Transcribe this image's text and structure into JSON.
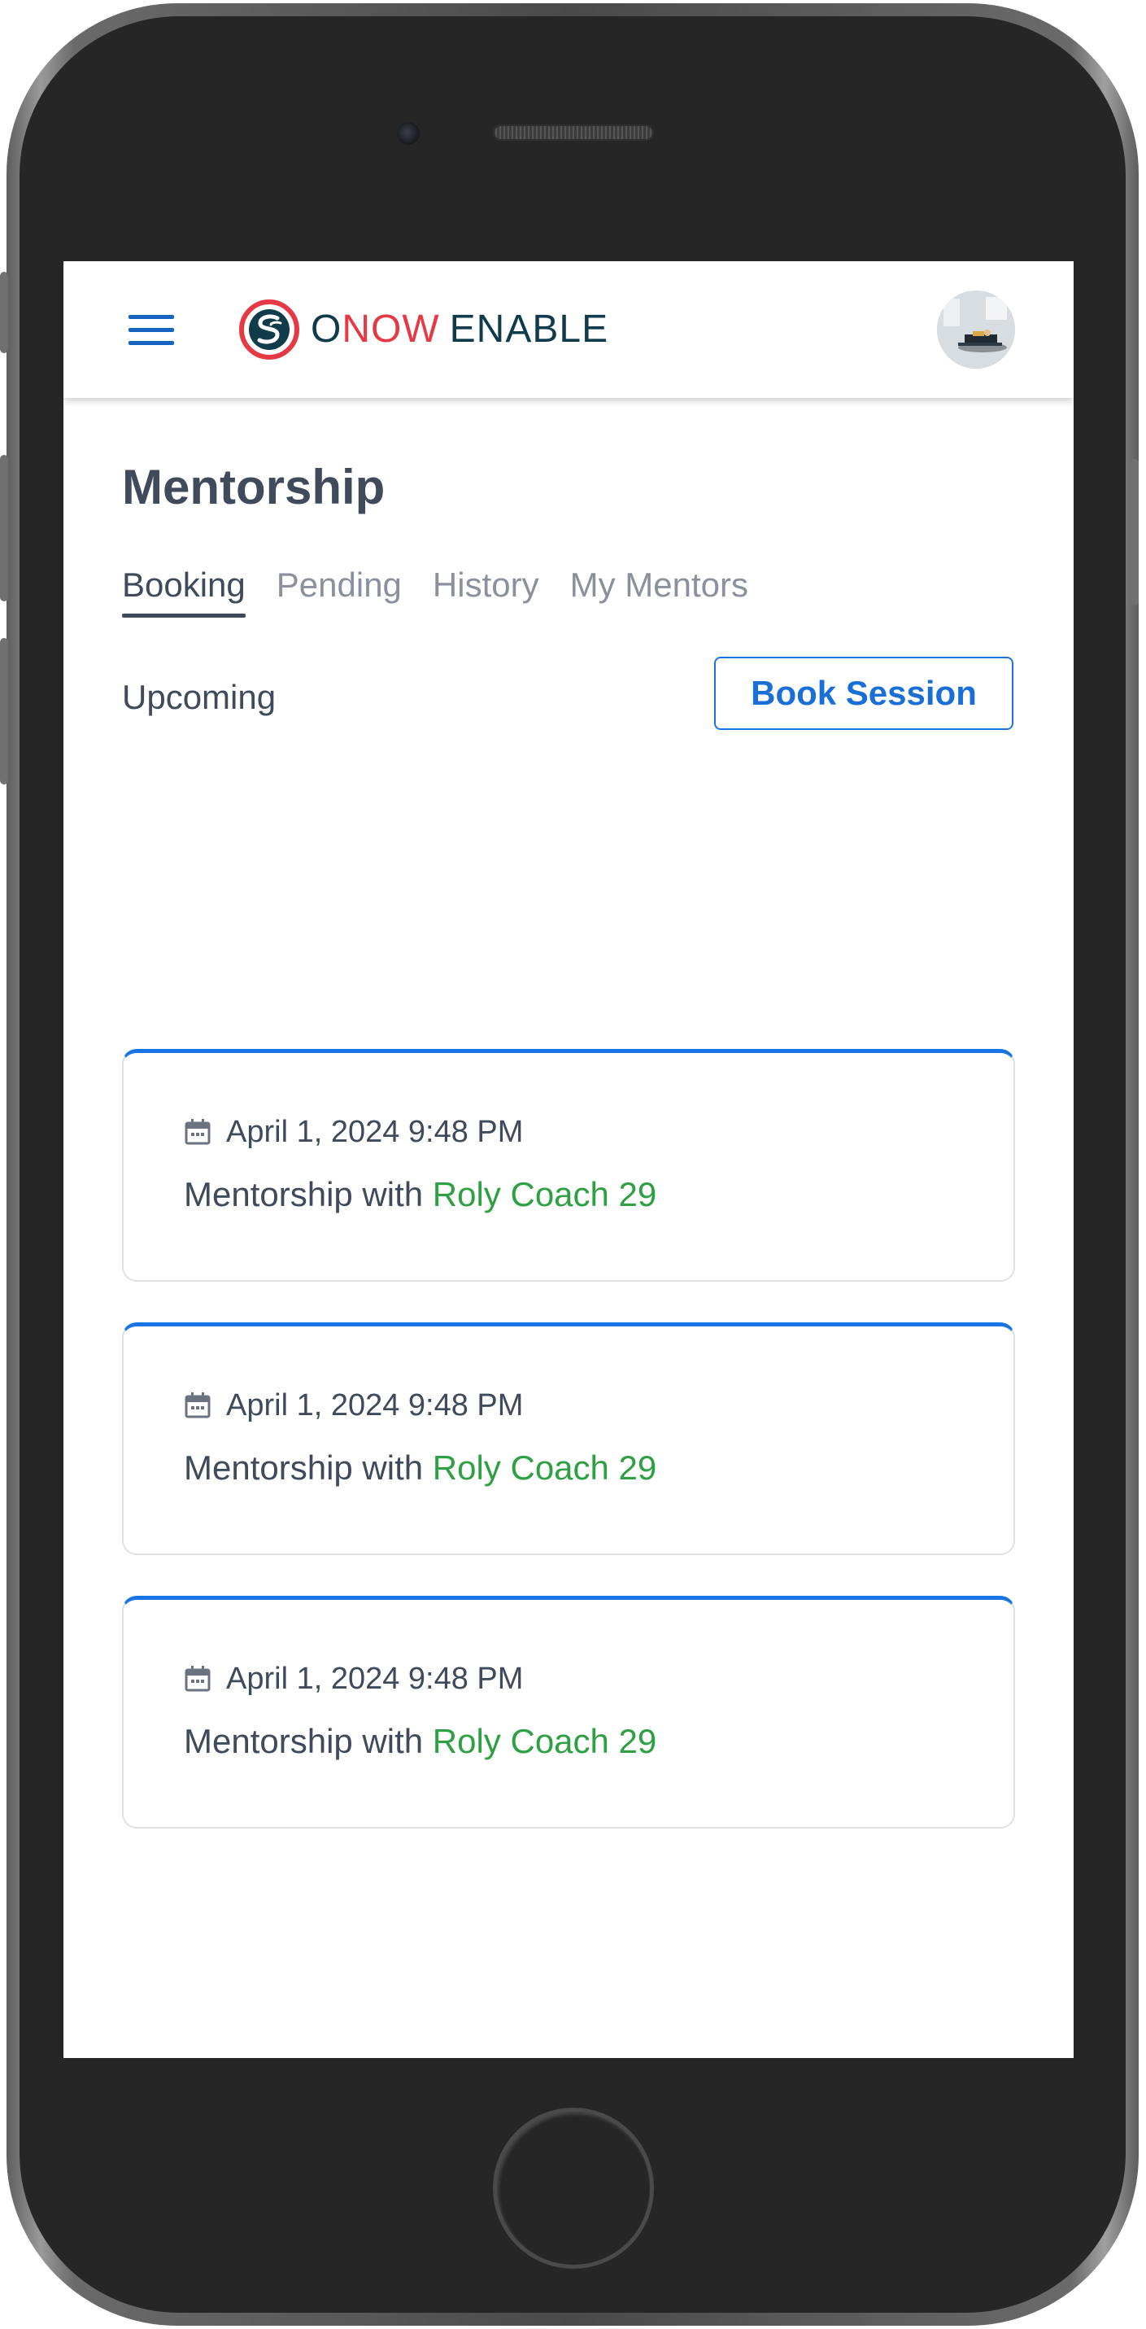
{
  "header": {
    "brand_o": "O",
    "brand_now": "NOW",
    "brand_enable": "ENABLE"
  },
  "page": {
    "title": "Mentorship",
    "tabs": [
      {
        "label": "Booking",
        "active": true
      },
      {
        "label": "Pending",
        "active": false
      },
      {
        "label": "History",
        "active": false
      },
      {
        "label": "My Mentors",
        "active": false
      }
    ],
    "section_label": "Upcoming",
    "book_button": "Book Session"
  },
  "sessions": [
    {
      "date": "April 1, 2024 9:48 PM",
      "prefix": "Mentorship with",
      "mentor": "Roly Coach 29"
    },
    {
      "date": "April 1, 2024 9:48 PM",
      "prefix": "Mentorship with",
      "mentor": "Roly Coach 29"
    },
    {
      "date": "April 1, 2024 9:48 PM",
      "prefix": "Mentorship with",
      "mentor": "Roly Coach 29"
    }
  ],
  "colors": {
    "accent_blue": "#1a73e8",
    "mentor_green": "#2ea043",
    "brand_red": "#e63946",
    "brand_dark": "#0f3b4a",
    "text": "#3f4a5a"
  },
  "icons": {
    "menu": "hamburger-menu-icon",
    "logo": "onow-logo-mark",
    "calendar": "calendar-icon"
  }
}
